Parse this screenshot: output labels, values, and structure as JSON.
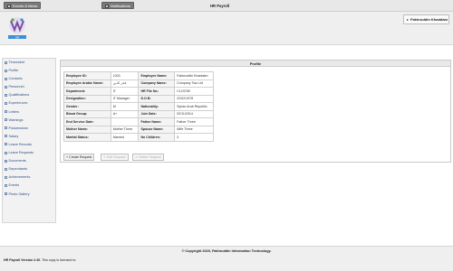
{
  "topbar": {
    "events_label": "Events & News",
    "notifications_label": "Notifications",
    "app_title": "HR Payroll"
  },
  "header": {
    "logo_text": "HR",
    "user_name": "Fakhruddin Khaddam"
  },
  "sidebar": {
    "items": [
      {
        "label": "Timesheet"
      },
      {
        "label": "Profile"
      },
      {
        "label": "Contacts"
      },
      {
        "label": "Personnel"
      },
      {
        "label": "Qualifications"
      },
      {
        "label": "Experiences"
      },
      {
        "label": "Letters"
      },
      {
        "label": "Warnings"
      },
      {
        "label": "Possessions"
      },
      {
        "label": "Salary"
      },
      {
        "label": "Leave Records"
      },
      {
        "label": "Leave Requests"
      },
      {
        "label": "Documents"
      },
      {
        "label": "Dependants"
      },
      {
        "label": "Achievements"
      },
      {
        "label": "Events"
      },
      {
        "label": "Photo Gallery"
      }
    ]
  },
  "profile": {
    "title": "Profile",
    "rows": [
      {
        "k1": "Employee ID:",
        "v1": "1003",
        "k2": "Employee Name:",
        "v2": "Fakhruddin Khaddam"
      },
      {
        "k1": "Employee Arabic Name:",
        "v1": "فخر الدين",
        "k2": "Company Name:",
        "v2": "Company Two Ltd"
      },
      {
        "k1": "Department:",
        "v1": "IT",
        "k2": "HR File No:",
        "v2": "C123789"
      },
      {
        "k1": "Designation:",
        "v1": "IT Manager",
        "k2": "D.O.B:",
        "v2": "22/02/1978"
      },
      {
        "k1": "Gender:",
        "v1": "M",
        "k2": "Nationality:",
        "v2": "Syrian Arab Republic"
      },
      {
        "k1": "Blood Group:",
        "v1": "A+",
        "k2": "Join Date:",
        "v2": "02/11/2014"
      },
      {
        "k1": "End Service Date:",
        "v1": "",
        "k2": "Father Name:",
        "v2": "Father Three"
      },
      {
        "k1": "Mother Name:",
        "v1": "Mother Three",
        "k2": "Spouse Name:",
        "v2": "Wife Three"
      },
      {
        "k1": "Marital Status:",
        "v1": "Married",
        "k2": "No Children:",
        "v2": "3"
      }
    ],
    "actions": {
      "create": "Create Request",
      "edit": "Edit Request",
      "delete": "Delete Request"
    }
  },
  "footer": {
    "copyright": "© Copyright 2020, Fakhruddin Information Technology.",
    "version_bold": "HR Payroll Version 2.40.",
    "version_rest": " This copy is licensed to:"
  },
  "colors": {
    "logo_purple": "#7b4fa3",
    "logo_green": "#5aa54a",
    "logo_blue": "#3d8fd6",
    "link_blue": "#2c4e85"
  }
}
